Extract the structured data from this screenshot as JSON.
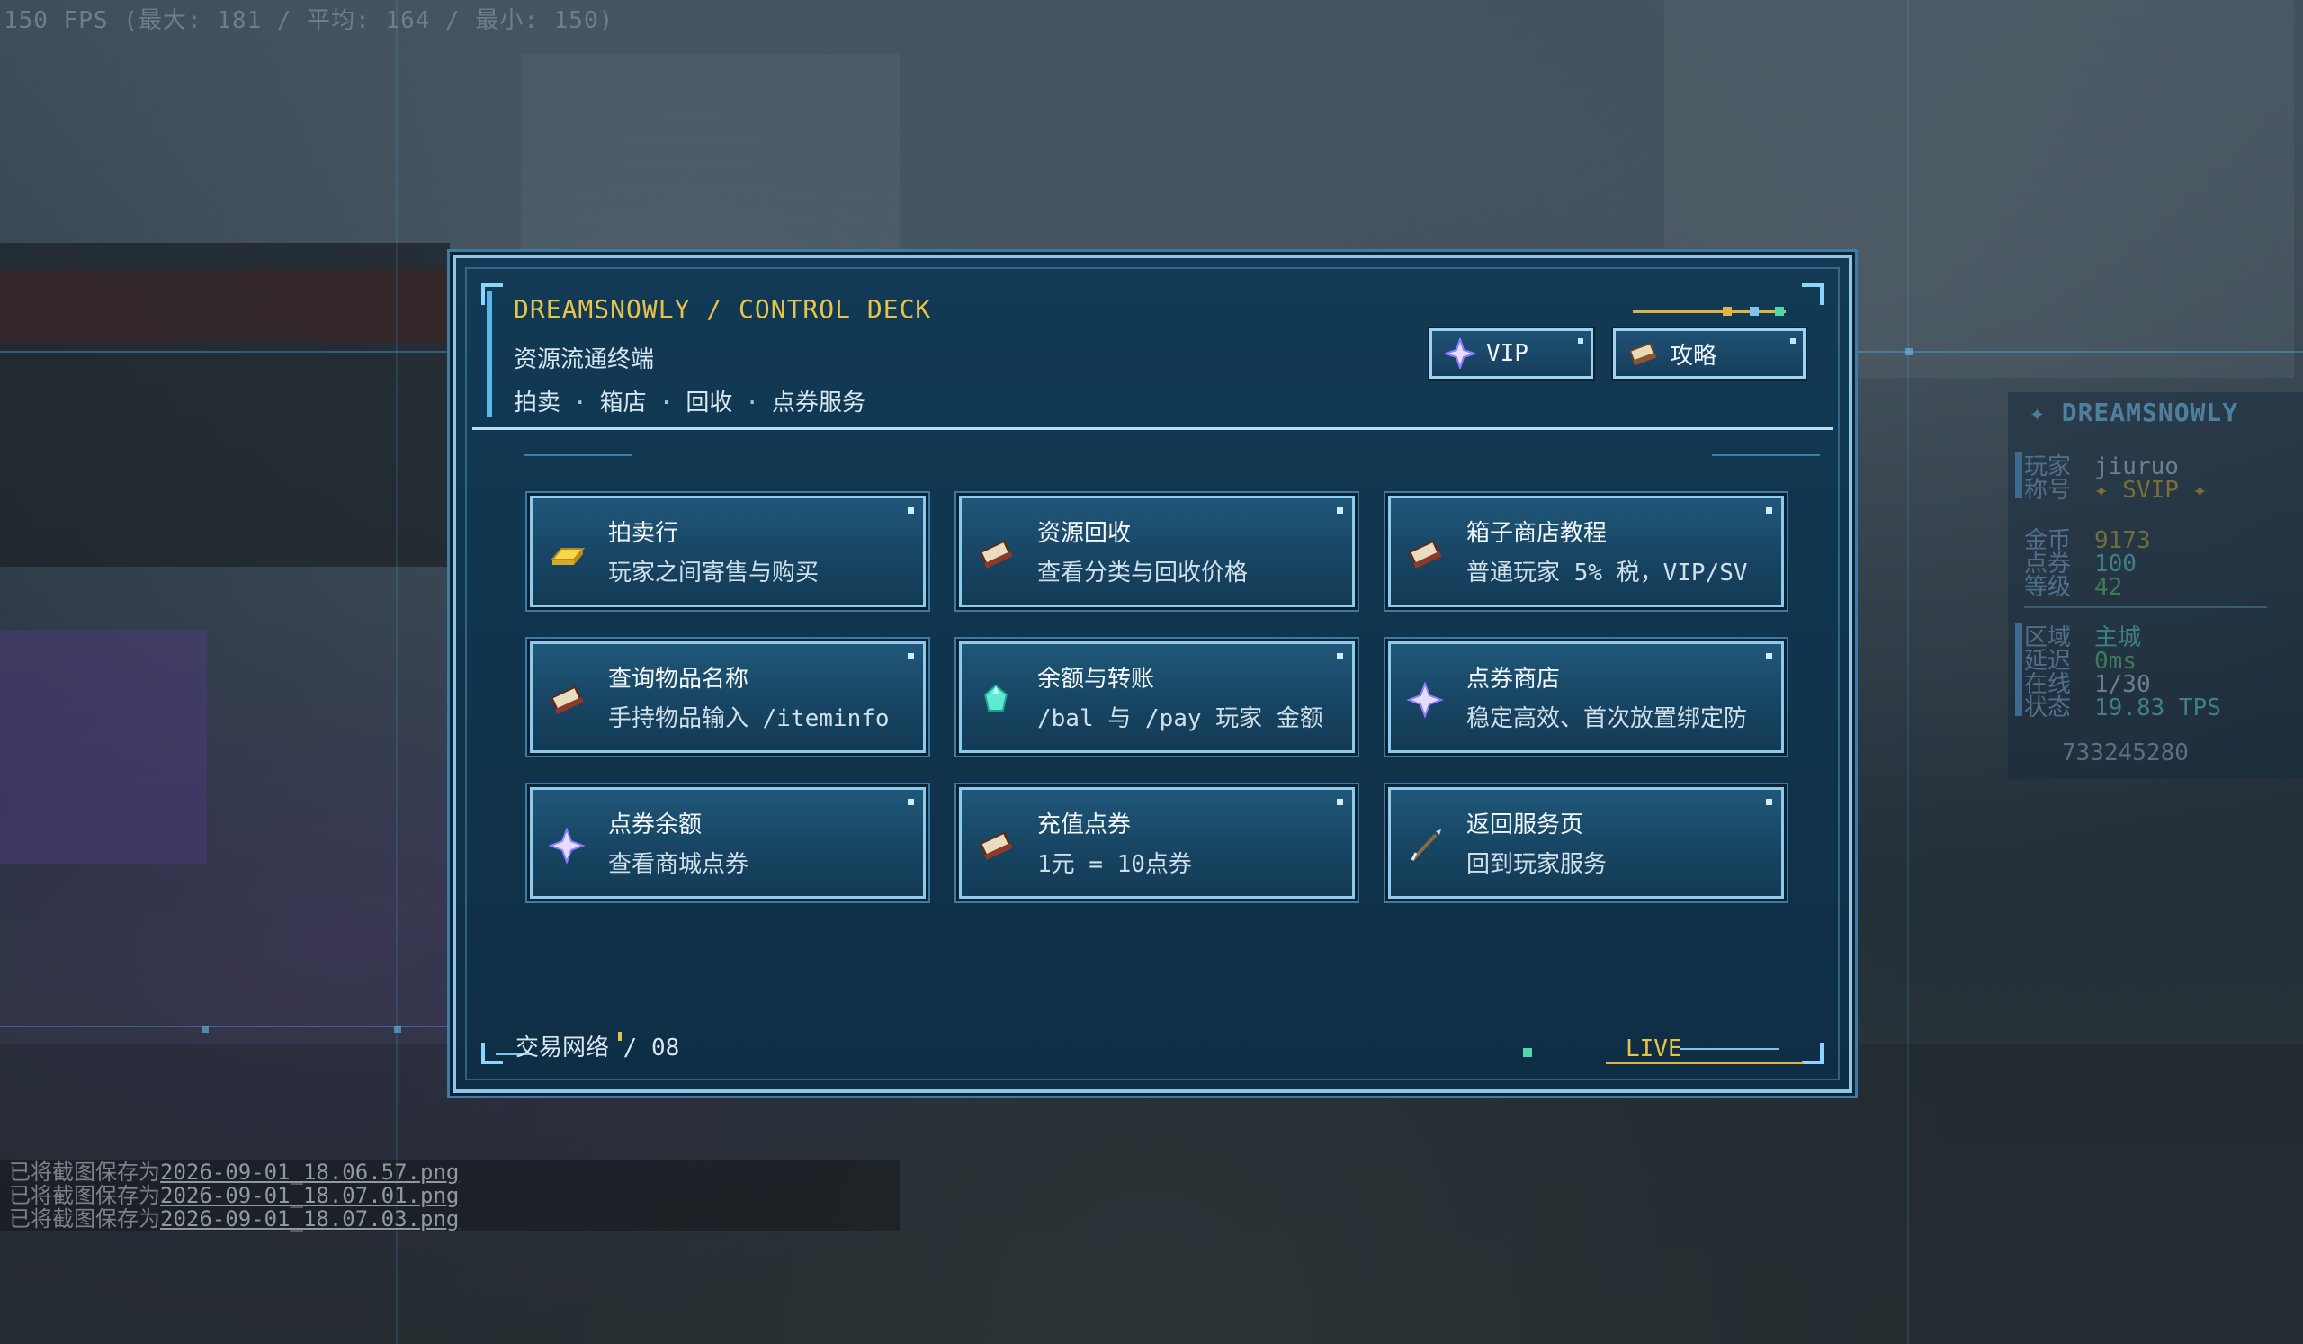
{
  "fps": "150 FPS (最大: 181 / 平均: 164 / 最小: 150)",
  "scoreboard": {
    "title": "✦ DREAMSNOWLY",
    "player_label": "玩家",
    "player_value": "jiuruo",
    "title_label": "称号",
    "title_value": "✦ SVIP ✦",
    "gold_label": "金币",
    "gold_value": "9173",
    "points_label": "点券",
    "points_value": "100",
    "level_label": "等级",
    "level_value": "42",
    "zone_label": "区域",
    "zone_value": "主城",
    "ping_label": "延迟",
    "ping_value": "0ms",
    "online_label": "在线",
    "online_value": "1/30",
    "status_label": "状态",
    "status_value": "19.83 TPS",
    "id": "733245280"
  },
  "chat": [
    {
      "prefix": "已将截图保存为",
      "file": "2026-09-01_18.06.57.png"
    },
    {
      "prefix": "已将截图保存为",
      "file": "2026-09-01_18.07.01.png"
    },
    {
      "prefix": "已将截图保存为",
      "file": "2026-09-01_18.07.03.png"
    }
  ],
  "panel": {
    "title": "DREAMSNOWLY / CONTROL DECK",
    "subtitle": "资源流通终端",
    "tags": [
      "拍卖",
      "箱店",
      "回收",
      "点券服务"
    ],
    "tag_sep": "·",
    "vip_label": "VIP",
    "guide_label": "攻略",
    "footer_left": "交易网络 / 08",
    "footer_right": "LIVE"
  },
  "cards": [
    {
      "title": "拍卖行",
      "desc": "玩家之间寄售与购买",
      "icon": "gold-ingot-icon"
    },
    {
      "title": "资源回收",
      "desc": "查看分类与回收价格",
      "icon": "book-icon"
    },
    {
      "title": "箱子商店教程",
      "desc": "普通玩家 5% 税，VIP/SV",
      "icon": "book-icon"
    },
    {
      "title": "查询物品名称",
      "desc": "手持物品输入 /iteminfo",
      "icon": "book-icon"
    },
    {
      "title": "余额与转账",
      "desc": "/bal 与 /pay 玩家 金额",
      "icon": "diamond-icon"
    },
    {
      "title": "点券商店",
      "desc": "稳定高效、首次放置绑定防",
      "icon": "star-icon"
    },
    {
      "title": "点券余额",
      "desc": "查看商城点券",
      "icon": "star-icon"
    },
    {
      "title": "充值点券",
      "desc": "1元 = 10点券",
      "icon": "book-icon"
    },
    {
      "title": "返回服务页",
      "desc": "回到玩家服务",
      "icon": "arrow-icon"
    }
  ],
  "colors": {
    "accent_gold": "#e8c34a",
    "panel_bg": "#123a55",
    "border": "#8fc6e6",
    "live_dot": "#4fd7b0"
  }
}
